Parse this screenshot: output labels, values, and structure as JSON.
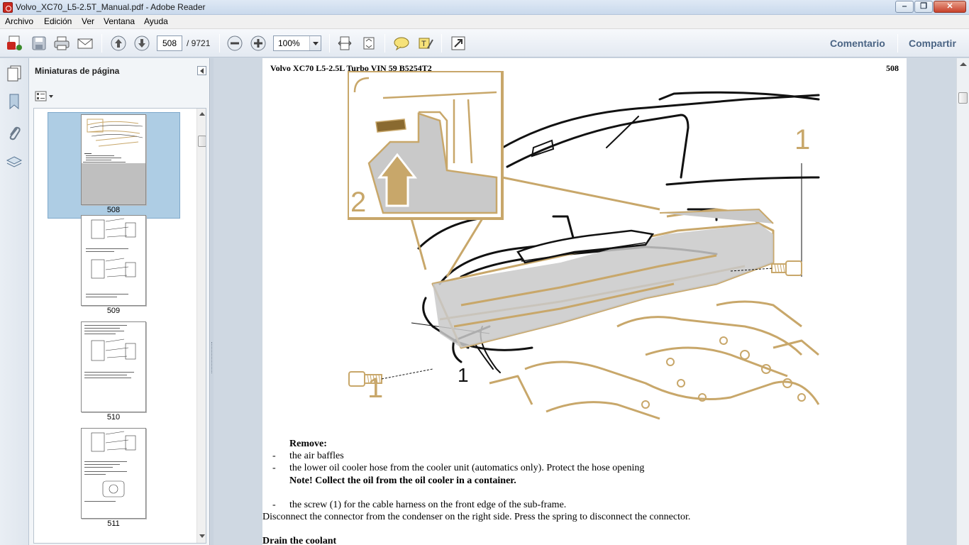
{
  "window": {
    "title": "Volvo_XC70_L5-2.5T_Manual.pdf - Adobe Reader",
    "min_glyph": "‒",
    "max_glyph": "❐",
    "close_glyph": "✕"
  },
  "menu": [
    "Archivo",
    "Edición",
    "Ver",
    "Ventana",
    "Ayuda"
  ],
  "toolbar": {
    "page_current": "508",
    "page_total": "/ 9721",
    "zoom": "100%",
    "comment_label": "Comentario",
    "share_label": "Compartir"
  },
  "nav_panel": {
    "title": "Miniaturas de página",
    "thumbnails": [
      {
        "label": "508",
        "selected": true
      },
      {
        "label": "509",
        "selected": false
      },
      {
        "label": "510",
        "selected": false
      },
      {
        "label": "511",
        "selected": false
      }
    ]
  },
  "page": {
    "header_left": "Volvo XC70 L5-2.5L Turbo VIN 59 B5254T2",
    "header_right": "508",
    "diagram_labels": {
      "callout_1_top": "1",
      "callout_1_left": "1",
      "callout_1_mid": "1",
      "callout_2": "2"
    },
    "lines": {
      "remove": "Remove:",
      "b1_dash": "-",
      "b1": "the air baffles",
      "b2_dash": "-",
      "b2": "the lower oil cooler hose from the cooler unit (automatics only). Protect the hose opening",
      "note": "Note! Collect the oil from the oil cooler in a container.",
      "b3_dash": "-",
      "b3": "the screw (1) for the cable harness on the front edge of the sub-frame.",
      "disconnect": "Disconnect the connector from the condenser on the right side. Press the spring to disconnect the connector.",
      "drain": "Drain the coolant"
    }
  },
  "colors": {
    "diagram_tan": "#c8a76a",
    "diagram_gray": "#c9c9c9",
    "selection": "#aecde4",
    "link_blue": "#4a6484"
  }
}
